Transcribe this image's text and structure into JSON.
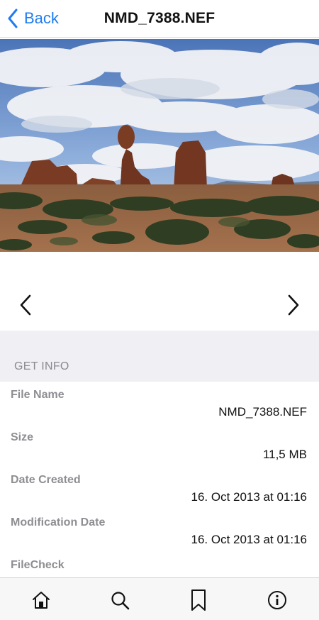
{
  "header": {
    "back_label": "Back",
    "title": "NMD_7388.NEF"
  },
  "info": {
    "section_title": "GET INFO",
    "rows": [
      {
        "label": "File Name",
        "value": "NMD_7388.NEF"
      },
      {
        "label": "Size",
        "value": "11,5 MB"
      },
      {
        "label": "Date Created",
        "value": "16. Oct 2013 at 01:16"
      },
      {
        "label": "Modification Date",
        "value": "16. Oct 2013 at 01:16"
      },
      {
        "label": "FileCheck",
        "value": ""
      }
    ]
  },
  "icons": {
    "back": "chevron-left-icon",
    "prev": "chevron-left-icon",
    "next": "chevron-right-icon",
    "home": "home-icon",
    "search": "search-icon",
    "bookmark": "bookmark-icon",
    "info": "info-icon"
  },
  "colors": {
    "accent": "#1e7cf2",
    "section_background": "#efeff4",
    "label_gray": "#8e8e93"
  }
}
